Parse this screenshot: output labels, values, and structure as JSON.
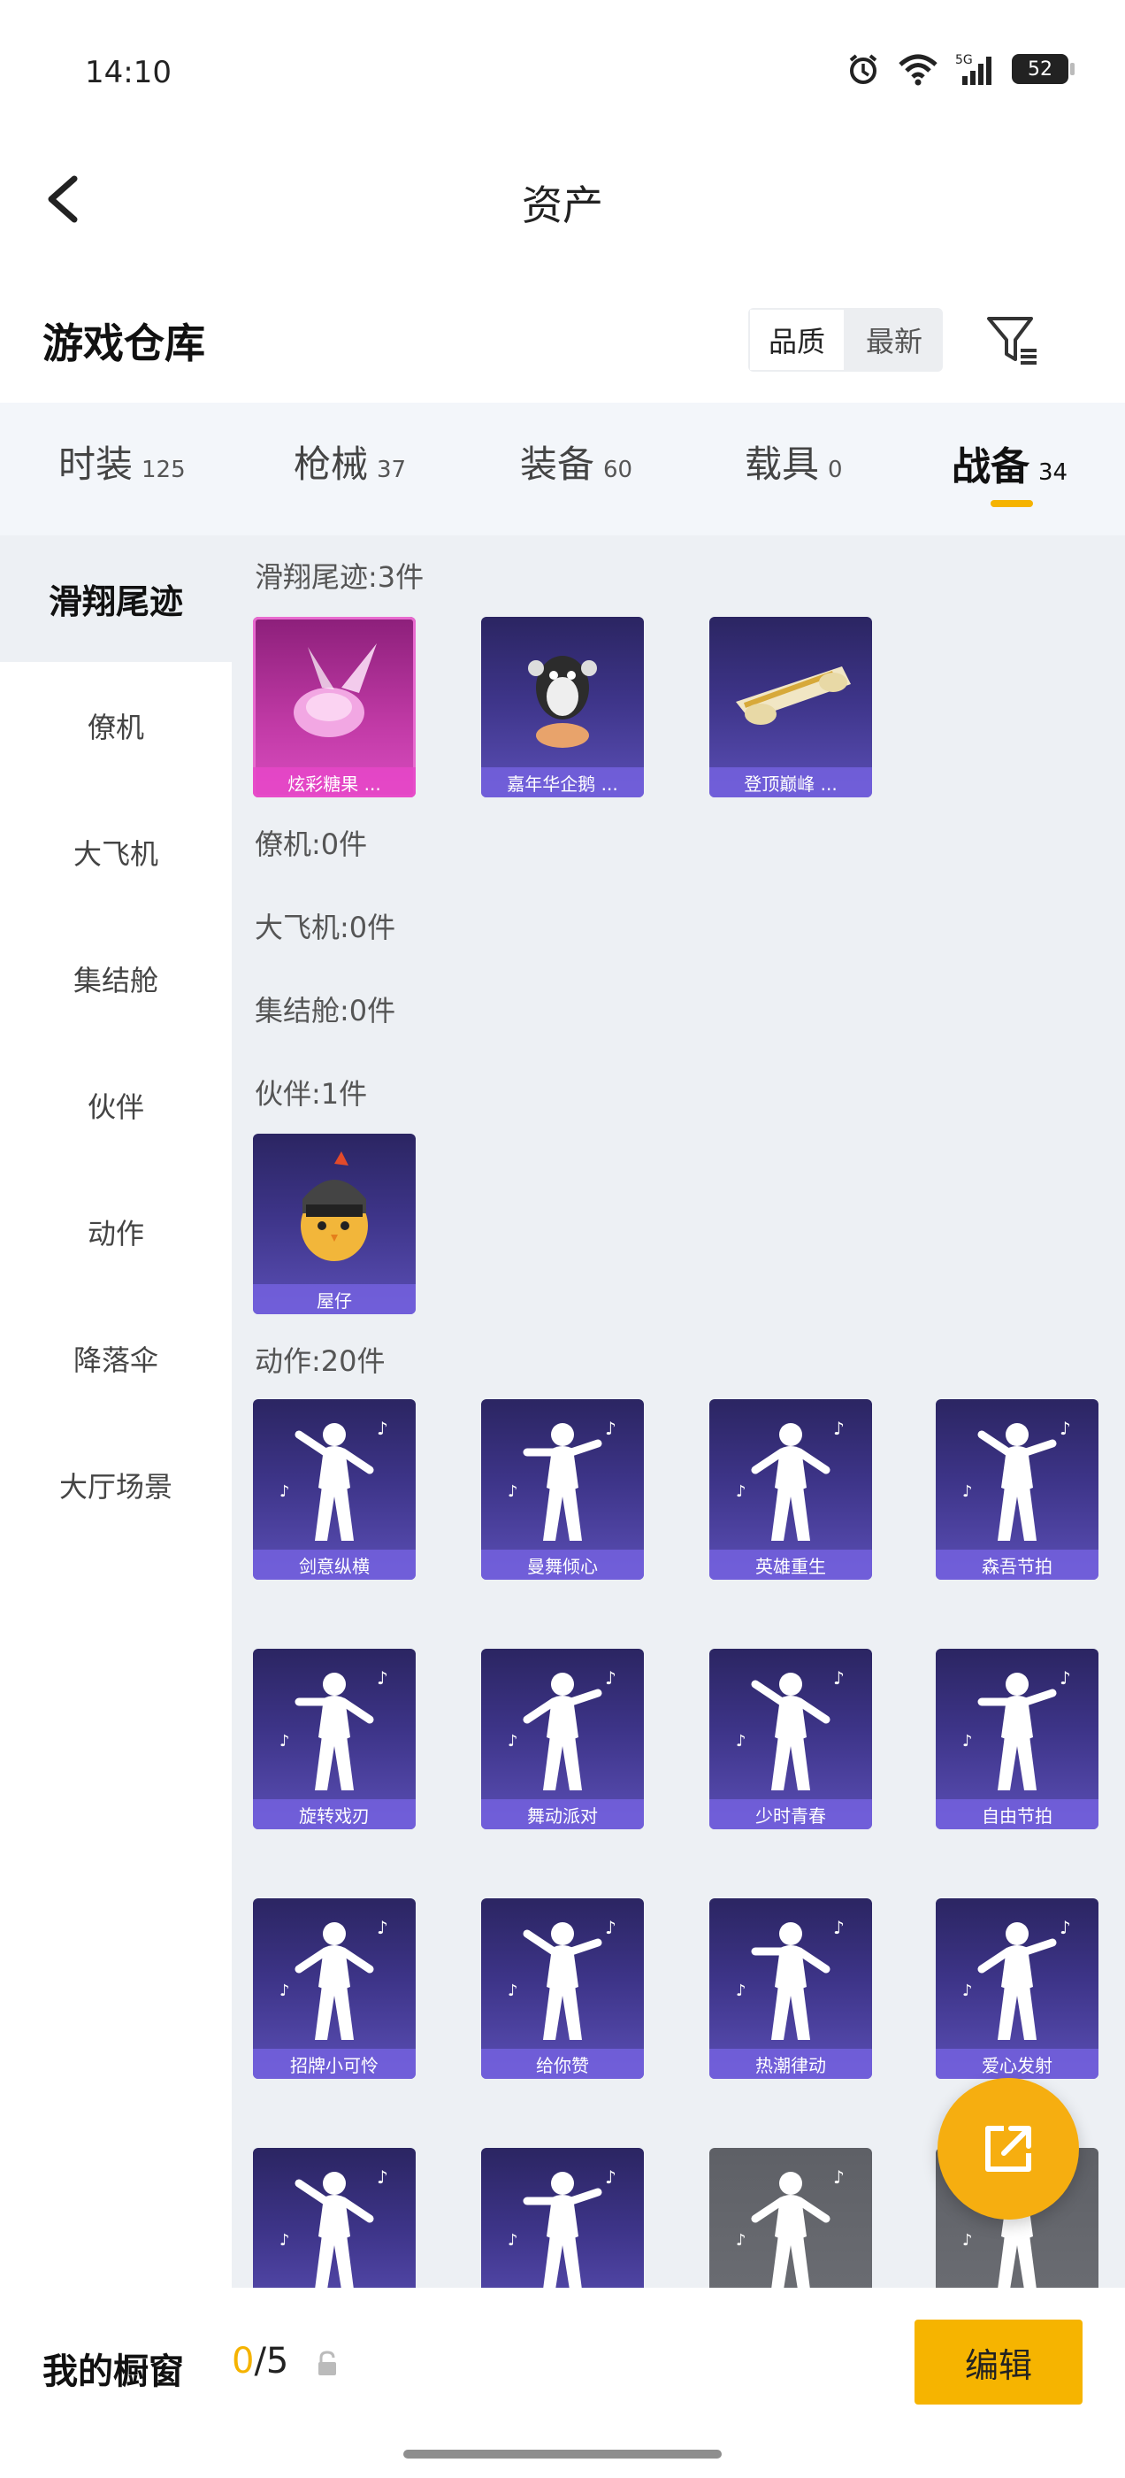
{
  "status_bar": {
    "time": "14:10",
    "battery": "52",
    "network": "5G"
  },
  "header": {
    "title": "资产"
  },
  "warehouse": {
    "title": "游戏仓库",
    "sort_options": [
      "品质",
      "最新"
    ],
    "active_sort": "品质"
  },
  "tabs": [
    {
      "label": "时装",
      "count": "125"
    },
    {
      "label": "枪械",
      "count": "37"
    },
    {
      "label": "装备",
      "count": "60"
    },
    {
      "label": "载具",
      "count": "0"
    },
    {
      "label": "战备",
      "count": "34",
      "active": true
    }
  ],
  "sidebar": {
    "items": [
      "滑翔尾迹",
      "僚机",
      "大飞机",
      "集结舱",
      "伙伴",
      "动作",
      "降落伞",
      "大厅场景"
    ],
    "active": "滑翔尾迹"
  },
  "sections": [
    {
      "label": "滑翔尾迹:3件",
      "items": [
        "炫彩糖果 ...",
        "嘉年华企鹅 ...",
        "登顶巅峰 ..."
      ]
    },
    {
      "label": "僚机:0件",
      "items": []
    },
    {
      "label": "大飞机:0件",
      "items": []
    },
    {
      "label": "集结舱:0件",
      "items": []
    },
    {
      "label": "伙伴:1件",
      "items": [
        "屋仔"
      ]
    },
    {
      "label": "动作:20件",
      "items": [
        "剑意纵横",
        "曼舞倾心",
        "英雄重生",
        "森吾节拍",
        "旋转戏刃",
        "舞动派对",
        "少时青春",
        "自由节拍",
        "招牌小可怜",
        "给你赞",
        "热潮律动",
        "爱心发射",
        "",
        "",
        "",
        ""
      ]
    }
  ],
  "bottom_bar": {
    "showcase_label": "我的橱窗",
    "count_current": "0",
    "count_total": "/5",
    "edit_label": "编辑"
  },
  "colors": {
    "accent": "#f5b300",
    "card_purple": "#3d3488",
    "card_pink": "#c13aa6",
    "content_bg": "#edf0f4"
  },
  "icons": {
    "back": "chevron-left-icon",
    "filter": "filter-icon",
    "fab": "share-external-icon",
    "lock": "lock-icon"
  }
}
